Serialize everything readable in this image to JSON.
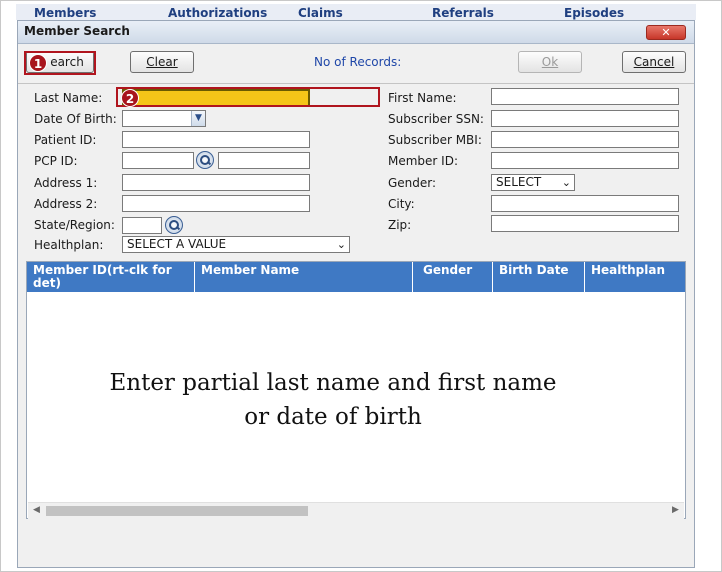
{
  "background_nav": [
    "Members",
    "Authorizations",
    "Claims",
    "Referrals",
    "Episodes"
  ],
  "dialog": {
    "title": "Member Search",
    "close_symbol": "✕"
  },
  "toolbar": {
    "search_label": "Search",
    "search_visible": "earch",
    "clear_label": "Clear",
    "records_label": "No of Records:",
    "ok_label": "Ok",
    "cancel_label": "Cancel"
  },
  "badges": {
    "one": "1",
    "two": "2"
  },
  "form": {
    "last_name_label": "Last Name:",
    "last_name_value": "",
    "dob_label": "Date Of Birth:",
    "patient_id_label": "Patient ID:",
    "pcp_id_label": "PCP ID:",
    "address1_label": "Address 1:",
    "address2_label": "Address 2:",
    "state_label": "State/Region:",
    "healthplan_label": "Healthplan:",
    "healthplan_value": "SELECT A VALUE",
    "first_name_label": "First Name:",
    "subscriber_ssn_label": "Subscriber SSN:",
    "subscriber_mbi_label": "Subscriber MBI:",
    "member_id_label": "Member ID:",
    "gender_label": "Gender:",
    "gender_value": "SELECT",
    "city_label": "City:",
    "zip_label": "Zip:"
  },
  "grid": {
    "columns": [
      "Member ID(rt-clk for det)",
      "Member Name",
      "Gender",
      "Birth Date",
      "Healthplan"
    ],
    "message_line1": "Enter partial last name and first name",
    "message_line2": "or date of birth"
  },
  "colors": {
    "header_blue": "#3f79c4",
    "highlight_red": "#b0151e",
    "focus_yellow": "#f5c518"
  }
}
